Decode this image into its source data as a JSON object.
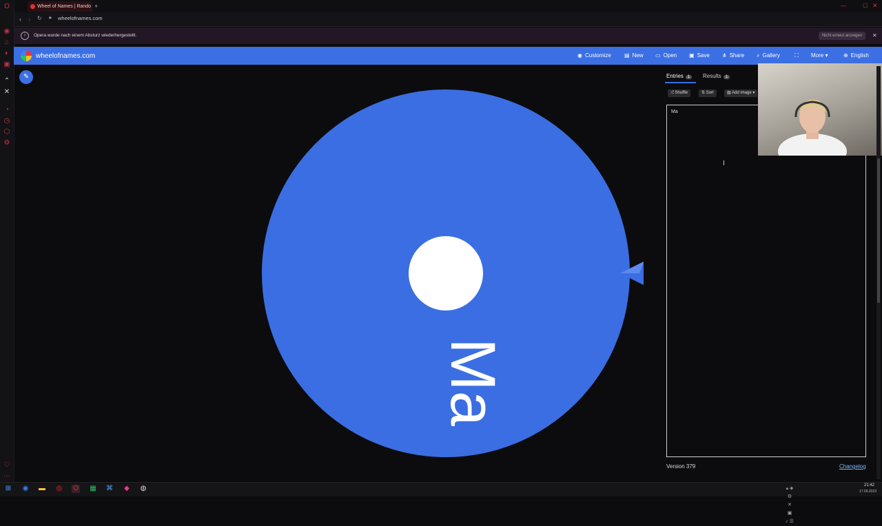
{
  "browser": {
    "tab_title": "Wheel of Names | Rando",
    "url": "wheelofnames.com",
    "info_message": "Opera wurde nach einem Absturz wiederhergestellt.",
    "info_dismiss": "Nicht erneut anzeigen"
  },
  "header": {
    "site_name": "wheelofnames.com",
    "nav": [
      {
        "label": "Customize",
        "icon": "palette-icon"
      },
      {
        "label": "New",
        "icon": "file-icon"
      },
      {
        "label": "Open",
        "icon": "folder-icon"
      },
      {
        "label": "Save",
        "icon": "save-icon"
      },
      {
        "label": "Share",
        "icon": "share-icon"
      },
      {
        "label": "Gallery",
        "icon": "search-icon"
      },
      {
        "label": "",
        "icon": "fullscreen-icon"
      },
      {
        "label": "More",
        "icon": "chevron-down-icon"
      },
      {
        "label": "English",
        "icon": "globe-icon"
      }
    ]
  },
  "wheel": {
    "color": "#3b6ee2",
    "segment_label": "Ma",
    "pointer_color": "#3b6ee2"
  },
  "panel": {
    "tabs": [
      {
        "label": "Entries",
        "count": "1"
      },
      {
        "label": "Results",
        "count": "1"
      }
    ],
    "tools": {
      "shuffle": "Shuffle",
      "sort": "Sort",
      "add_image": "Add image"
    },
    "entries": [
      "Ma"
    ],
    "version": "Version 379",
    "changelog": "Changelog"
  },
  "taskbar": {
    "time": "21:42",
    "date": "17.09.2023"
  }
}
